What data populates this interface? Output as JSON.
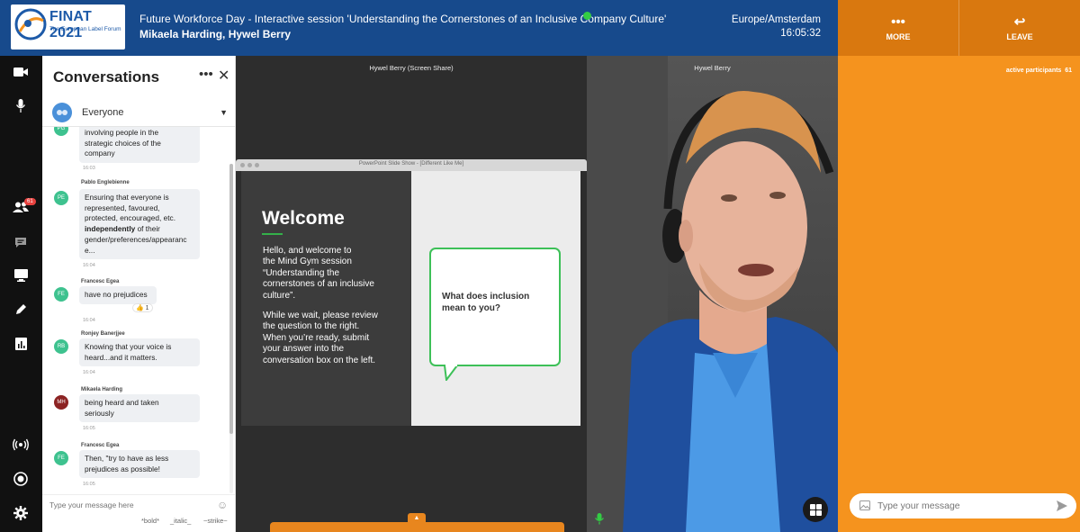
{
  "header": {
    "logo_title": "FINAT 2021",
    "logo_subtitle": "The European Label Forum",
    "session_title": "Future Workforce Day - Interactive session 'Understanding the Cornerstones of an Inclusive Company Culture'",
    "speakers": "Mikaela Harding, Hywel Berry",
    "timezone": "Europe/Amsterdam",
    "time": "16:05:32",
    "more_label": "MORE",
    "leave_label": "LEAVE",
    "live_color": "#33cc44"
  },
  "rail": {
    "participants_badge": "61",
    "icons": [
      "video-camera-icon",
      "microphone-icon",
      "participants-icon",
      "chat-icon",
      "screen-share-icon",
      "pen-icon",
      "chart-icon",
      "broadcast-icon",
      "record-icon",
      "gear-icon"
    ]
  },
  "chat": {
    "title": "Conversations",
    "audience": "Everyone",
    "messages": [
      {
        "author": "",
        "initials": "PG",
        "text_lines": [
          "involving people in the",
          "strategic choices of the",
          "company"
        ],
        "time": "16:03"
      },
      {
        "author": "Pablo Englebienne",
        "initials": "PE",
        "text_lines": [
          "Ensuring that everyone is",
          "represented, favoured,",
          "protected, encouraged, etc.",
          "of their",
          "gender/preferences/appearanc",
          "e..."
        ],
        "bold_word": "independently",
        "time": "16:04"
      },
      {
        "author": "Francesc Egea",
        "initials": "FE",
        "text_lines": [
          "have no prejudices"
        ],
        "reaction": "👍 1",
        "time": "16:04"
      },
      {
        "author": "Ronjey Banerjjee",
        "initials": "RB",
        "text_lines": [
          "Knowing that your voice is",
          "heard...and it matters."
        ],
        "time": "16:04"
      },
      {
        "author": "Mikaela Harding",
        "initials": "MH",
        "text_lines": [
          "being heard and taken",
          "seriously"
        ],
        "time": "16:05"
      },
      {
        "author": "Francesc Egea",
        "initials": "FE",
        "text_lines": [
          "Then, \"try to have as less",
          "prejudices as possible!"
        ],
        "time": "16:05"
      }
    ],
    "input_placeholder": "Type your message here",
    "format_bold": "*bold*",
    "format_italic": "_italic_",
    "format_strike": "~strike~"
  },
  "stage": {
    "share_label": "Hywel Berry (Screen Share)",
    "camera_label": "Hywel Berry",
    "ppt_window_title": "PowerPoint Slide Show - [Different Like Me]",
    "slide": {
      "heading": "Welcome",
      "intro_lines": [
        "Hello, and welcome to",
        "the Mind Gym session",
        "“Understanding the",
        "cornerstones of an inclusive",
        "culture”."
      ],
      "wait_lines": [
        "While we wait, please review",
        "the question to the right.",
        "When you’re ready, submit",
        "your answer into the",
        "conversation box on the left."
      ],
      "question_lines": [
        "What does inclusion",
        "mean to you?"
      ]
    }
  },
  "side": {
    "active_participants_label": "active participants",
    "active_participants_count": "61",
    "input_placeholder": "Type your message"
  },
  "colors": {
    "header_blue": "#174a8c",
    "accent_orange": "#f5931e",
    "button_orange": "#d9780f",
    "slide_green": "#3dc058"
  }
}
